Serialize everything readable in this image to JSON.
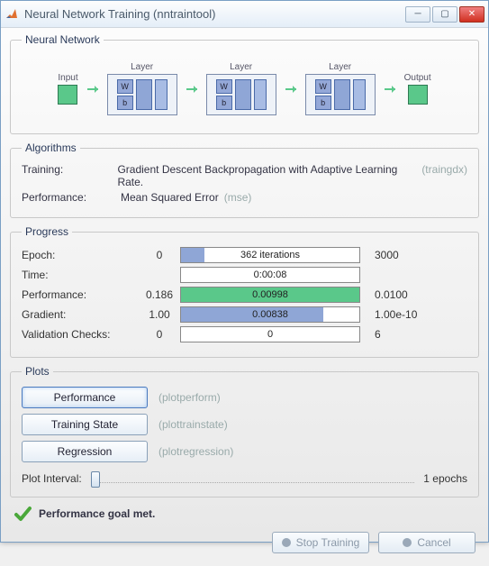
{
  "window": {
    "title": "Neural Network Training (nntraintool)"
  },
  "sections": {
    "network": "Neural Network",
    "algorithms": "Algorithms",
    "progress": "Progress",
    "plots": "Plots"
  },
  "diagram": {
    "input": "Input",
    "layer": "Layer",
    "output": "Output",
    "w": "W",
    "b": "b"
  },
  "algorithms": {
    "training_label": "Training:",
    "training_value": "Gradient Descent Backpropagation with Adaptive Learning Rate.",
    "training_hint": "(traingdx)",
    "performance_label": "Performance:",
    "performance_value": "Mean Squared Error",
    "performance_hint": "(mse)"
  },
  "progress": {
    "rows": [
      {
        "label": "Epoch:",
        "start": "0",
        "text": "362 iterations",
        "end": "3000",
        "fill_pct": 13,
        "color": "blue"
      },
      {
        "label": "Time:",
        "start": "",
        "text": "0:00:08",
        "end": "",
        "fill_pct": 0,
        "color": "blue"
      },
      {
        "label": "Performance:",
        "start": "0.186",
        "text": "0.00998",
        "end": "0.0100",
        "fill_pct": 100,
        "color": "green"
      },
      {
        "label": "Gradient:",
        "start": "1.00",
        "text": "0.00838",
        "end": "1.00e-10",
        "fill_pct": 80,
        "color": "blue"
      },
      {
        "label": "Validation Checks:",
        "start": "0",
        "text": "0",
        "end": "6",
        "fill_pct": 0,
        "color": "blue"
      }
    ]
  },
  "plots": {
    "buttons": [
      {
        "label": "Performance",
        "hint": "(plotperform)",
        "active": true
      },
      {
        "label": "Training State",
        "hint": "(plottrainstate)",
        "active": false
      },
      {
        "label": "Regression",
        "hint": "(plotregression)",
        "active": false
      }
    ],
    "interval_label": "Plot Interval:",
    "interval_value": "1 epochs"
  },
  "status": {
    "text": "Performance goal met."
  },
  "footer": {
    "stop": "Stop Training",
    "cancel": "Cancel"
  }
}
